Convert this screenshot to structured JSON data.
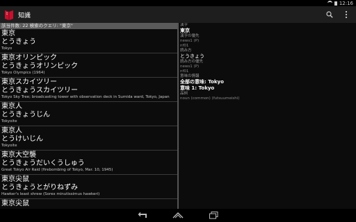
{
  "status": {
    "time": "12:16"
  },
  "app": {
    "title": "知識"
  },
  "results": {
    "count_text": "該当件数: 22 検索のクエリ: \"東京\"",
    "items": [
      {
        "kanji": "東京",
        "reading": "とうきょう",
        "gloss": "Tokyo"
      },
      {
        "kanji": "東京オリンピック",
        "reading": "とうきょうオリンピック",
        "gloss": "Tokyo Olympics (1964)"
      },
      {
        "kanji": "東京スカイツリー",
        "reading": "とうきょうスカイツリー",
        "gloss": "Tokyo Sky Tree; broadcasting tower with observation deck in Sumida ward, Tokyo, Japan"
      },
      {
        "kanji": "東京人",
        "reading": "とうきょうじん",
        "gloss": "Tokyoite"
      },
      {
        "kanji": "東京人",
        "reading": "とうけいじん",
        "gloss": "Tokyoite"
      },
      {
        "kanji": "東京大空襲",
        "reading": "とうきょうだいくうしゅう",
        "gloss": "Great Tokyo Air Raid (firebombing of Tokyo, Mar. 10, 1945)"
      },
      {
        "kanji": "東京尖鼠",
        "reading": "とうきょうとがりねずみ",
        "gloss": "Hawker's least shrew (Sorex minutissimus hawkeri)"
      },
      {
        "kanji": "東京尖鼠",
        "reading": "",
        "gloss": ""
      }
    ]
  },
  "detail": {
    "kanji_label": "漢字",
    "kanji_value": "東京",
    "kanji_priority_label": "漢字の優先",
    "kanji_priority_1": "news1 (P)",
    "kanji_priority_2": "nf01",
    "reading_label": "読み方",
    "reading_value": "とうきょう",
    "reading_priority_label": "読み方の優先",
    "reading_priority_1": "news1 (P)",
    "reading_priority_2": "nf01",
    "sense_label": "意味の情報",
    "all_meanings": "全部の意味: Tokyo",
    "meaning_1": "意味 1: Tokyo",
    "pos_label": "品詞",
    "pos_value": "noun (common) (futsuumeishi)"
  }
}
